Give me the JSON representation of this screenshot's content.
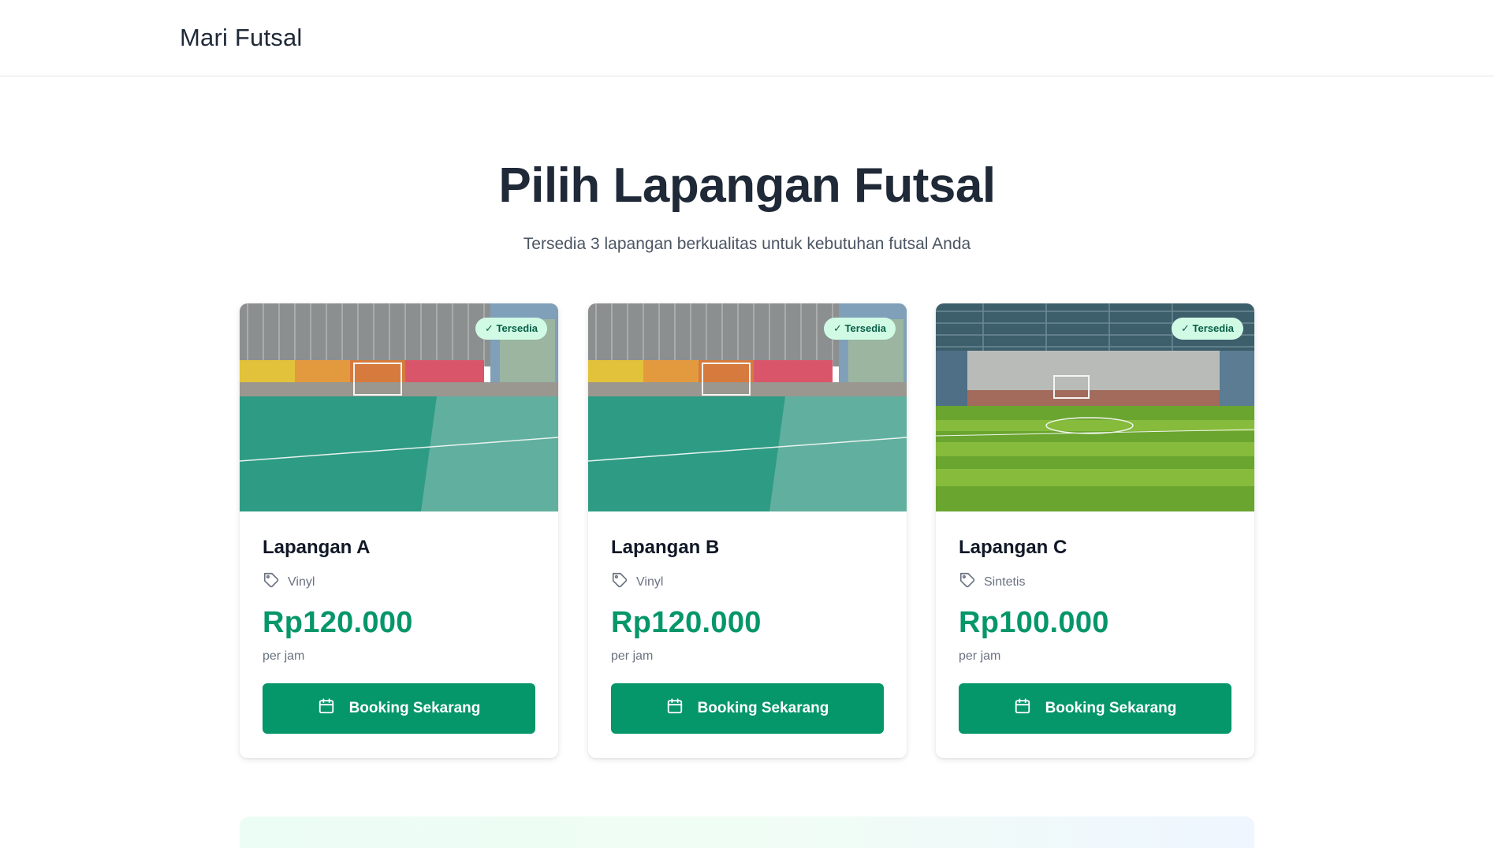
{
  "navbar": {
    "brand": "Mari Futsal"
  },
  "hero": {
    "title": "Pilih Lapangan Futsal",
    "subtitle": "Tersedia 3 lapangan berkualitas untuk kebutuhan futsal Anda"
  },
  "courts": [
    {
      "name": "Lapangan A",
      "type": "Vinyl",
      "price": "Rp120.000",
      "unit": "per jam",
      "status": "✓ Tersedia",
      "button_label": "Booking Sekarang",
      "surface": "vinyl-green"
    },
    {
      "name": "Lapangan B",
      "type": "Vinyl",
      "price": "Rp120.000",
      "unit": "per jam",
      "status": "✓ Tersedia",
      "button_label": "Booking Sekarang",
      "surface": "vinyl-green"
    },
    {
      "name": "Lapangan C",
      "type": "Sintetis",
      "price": "Rp100.000",
      "unit": "per jam",
      "status": "✓ Tersedia",
      "button_label": "Booking Sekarang",
      "surface": "synthetic-grass"
    }
  ],
  "icons": {
    "type": "tag-icon",
    "button": "calendar-icon"
  },
  "colors": {
    "accent": "#059669",
    "badge_bg": "#d1fae5",
    "badge_text": "#065f46",
    "heading": "#1f2937"
  }
}
